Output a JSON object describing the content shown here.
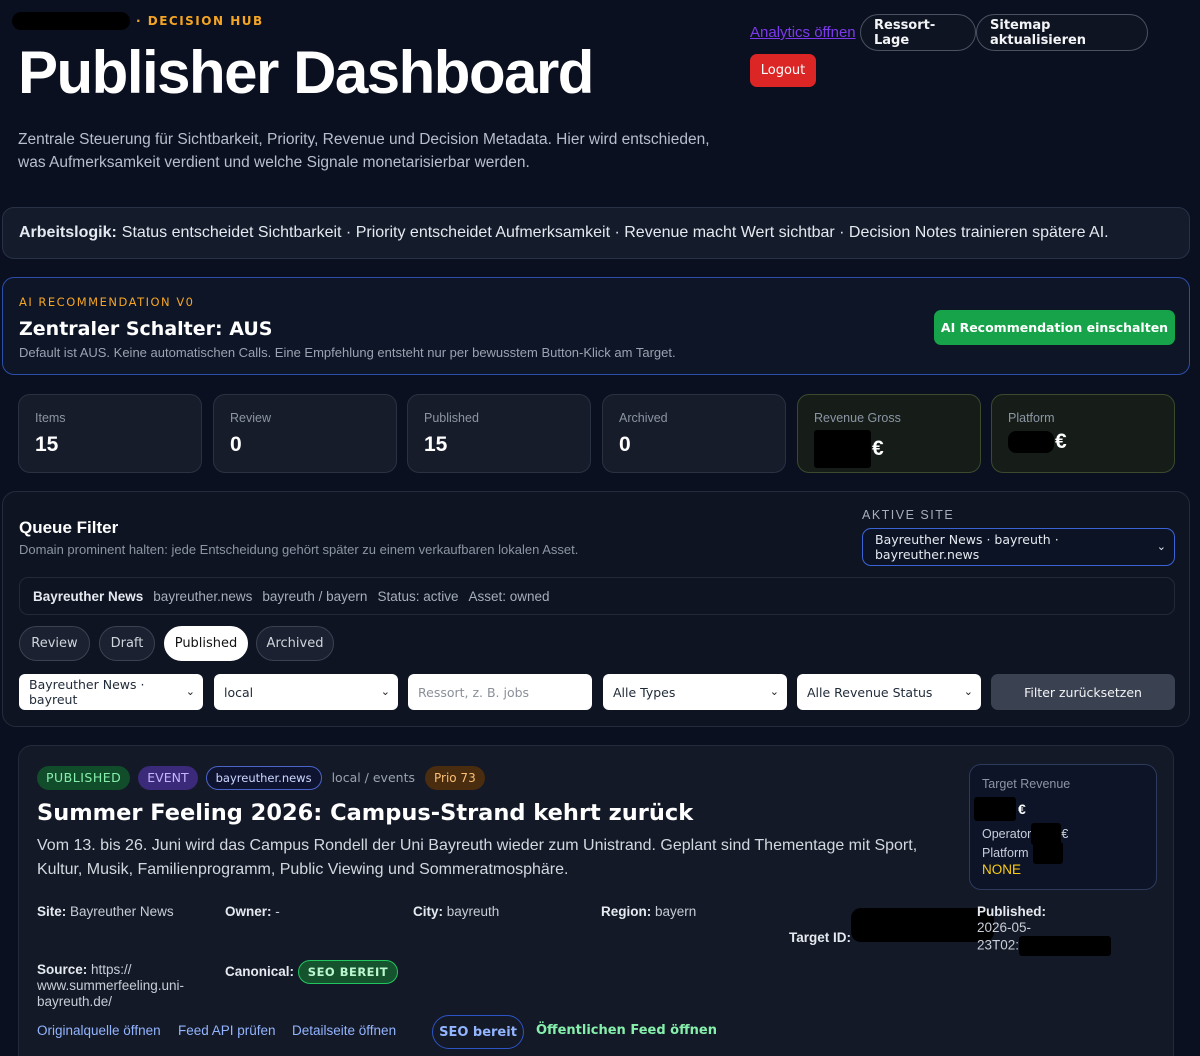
{
  "header": {
    "eyebrow": "· DECISION HUB",
    "title": "Publisher Dashboard",
    "subtitle": "Zentrale Steuerung für Sichtbarkeit, Priority, Revenue und Decision Metadata. Hier wird entschieden, was Aufmerksamkeit verdient und welche Signale monetarisierbar werden."
  },
  "top_actions": {
    "analytics_link": "Analytics öffnen",
    "ressort_button": "Ressort-Lage",
    "sitemap_button": "Sitemap aktualisieren",
    "logout_button": "Logout"
  },
  "logic_banner": {
    "label": "Arbeitslogik:",
    "text": "Status entscheidet Sichtbarkeit · Priority entscheidet Aufmerksamkeit · Revenue macht Wert sichtbar · Decision Notes trainieren spätere AI."
  },
  "ai_panel": {
    "eyebrow": "AI RECOMMENDATION V0",
    "title": "Zentraler Schalter: AUS",
    "description": "Default ist AUS. Keine automatischen Calls. Eine Empfehlung entsteht nur per bewusstem Button-Klick am Target.",
    "button": "AI Recommendation einschalten"
  },
  "stats": [
    {
      "label": "Items",
      "value": "15"
    },
    {
      "label": "Review",
      "value": "0"
    },
    {
      "label": "Published",
      "value": "15"
    },
    {
      "label": "Archived",
      "value": "0"
    },
    {
      "label": "Revenue Gross",
      "currency": "€"
    },
    {
      "label": "Platform",
      "currency": "€"
    }
  ],
  "queue": {
    "title": "Queue Filter",
    "description": "Domain prominent halten: jede Entscheidung gehört später zu einem verkaufbaren lokalen Asset.",
    "site_label": "AKTIVE SITE",
    "site_value": "Bayreuther News · bayreuth · bayreuther.news",
    "meta": {
      "name": "Bayreuther News",
      "domain": "bayreuther.news",
      "region": "bayreuth / bayern",
      "status": "Status: active",
      "asset": "Asset: owned"
    },
    "tabs": [
      "Review",
      "Draft",
      "Published",
      "Archived"
    ],
    "active_tab": "Published",
    "filters": {
      "site": "Bayreuther News · bayreut",
      "scope": "local",
      "ressort_placeholder": "Ressort, z. B. jobs",
      "types": "Alle Types",
      "revenue_status": "Alle Revenue Status",
      "reset": "Filter zurücksetzen"
    }
  },
  "item": {
    "badges": {
      "status": "PUBLISHED",
      "type": "EVENT",
      "domain": "bayreuther.news",
      "path": "local / events",
      "priority": "Prio 73"
    },
    "title": "Summer Feeling 2026: Campus-Strand kehrt zurück",
    "description": "Vom 13. bis 26. Juni wird das Campus Rondell der Uni Bayreuth wieder zum Unistrand. Geplant sind Thementage mit Sport, Kultur, Musik, Familienprogramm, Public Viewing und Sommeratmosphäre.",
    "revenue": {
      "label": "Target Revenue",
      "currency": "€",
      "operator_label": "Operator",
      "platform_label": "Platform",
      "status": "NONE"
    },
    "meta": {
      "site_label": "Site:",
      "site_value": "Bayreuther News",
      "owner_label": "Owner:",
      "owner_value": "-",
      "city_label": "City:",
      "city_value": "bayreuth",
      "region_label": "Region:",
      "region_value": "bayern",
      "target_label": "Target ID:",
      "published_label": "Published:",
      "published_value_1": "2026-05-",
      "published_value_2": "23T02:",
      "source_label": "Source:",
      "source_value_1": "https://",
      "source_value_2": "www.summerfeeling.uni-",
      "source_value_3": "bayreuth.de/",
      "canonical_label": "Canonical:",
      "canonical_badge": "SEO BEREIT"
    },
    "links": {
      "original": "Originalquelle öffnen",
      "feed_api": "Feed API prüfen",
      "detail": "Detailseite öffnen",
      "seo": "SEO bereit",
      "public_feed": "Öffentlichen Feed öffnen"
    }
  }
}
